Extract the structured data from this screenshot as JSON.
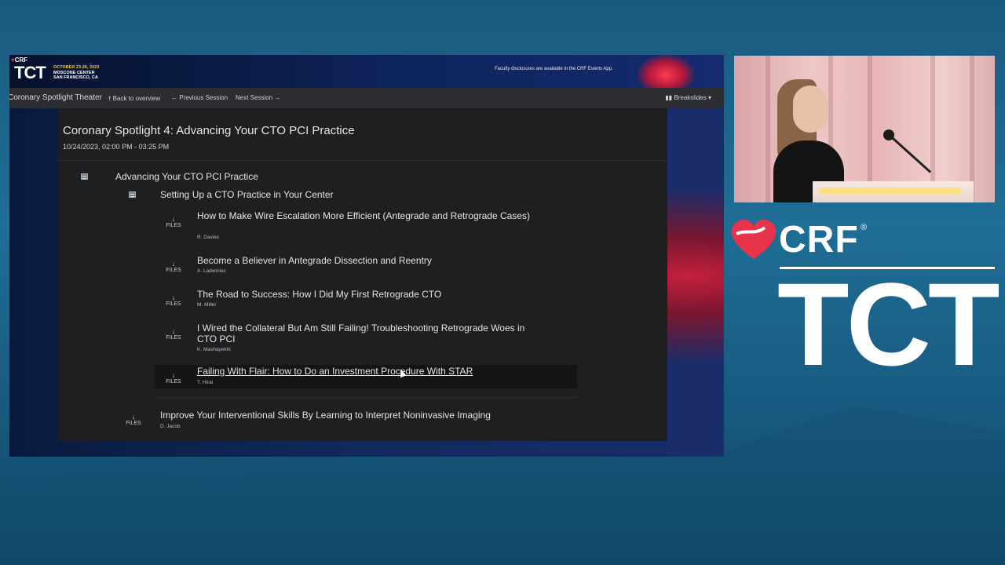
{
  "window": {
    "header": {
      "crf_label": "CRF",
      "tct_label": "TCT",
      "dates_line": "OCTOBER 23-26, 2023",
      "venue_line": "MOSCONE CENTER",
      "city_line": "SAN FRANCISCO, CA",
      "disclosure": "Faculty disclosures are available in the CRF Events App."
    },
    "navbar": {
      "brand": "Coronary Spotlight Theater",
      "back": "Back to overview",
      "prev": "Previous Session",
      "next": "Next Session",
      "breakslides": "Breakslides"
    },
    "session": {
      "title": "Coronary Spotlight 4: Advancing Your CTO PCI Practice",
      "datetime": "10/24/2023, 02:00 PM - 03:25 PM",
      "section": "Advancing Your CTO PCI Practice",
      "subsection": "Setting Up a CTO Practice in Your Center",
      "files_label": "FILES",
      "talks": [
        {
          "title": "How to Make Wire Escalation More Efficient (Antegrade and Retrograde Cases)",
          "speaker": "R. Davies"
        },
        {
          "title": "Become a Believer in Antegrade Dissection and Reentry",
          "speaker": "A. Ladwiniec"
        },
        {
          "title": "The Road to Success: How I Did My First Retrograde CTO",
          "speaker": "M. Miller"
        },
        {
          "title": "I Wired the Collateral But Am Still Failing! Troubleshooting Retrograde Woes in CTO PCI",
          "speaker": "K. Mashayekhi"
        },
        {
          "title": "Failing With Flair: How to Do an Investment Procedure With STAR",
          "speaker": "T. Hirai"
        }
      ],
      "next_talk": {
        "title": "Improve Your Interventional Skills By Learning to Interpret Noninvasive Imaging",
        "speaker": "D. Jacob"
      }
    }
  },
  "branding": {
    "crf": "CRF",
    "registered": "®",
    "tct": "TCT"
  },
  "colors": {
    "accent_red": "#e8344a",
    "panel_bg": "#1d1f21",
    "navbar_bg": "#2b2d30"
  }
}
